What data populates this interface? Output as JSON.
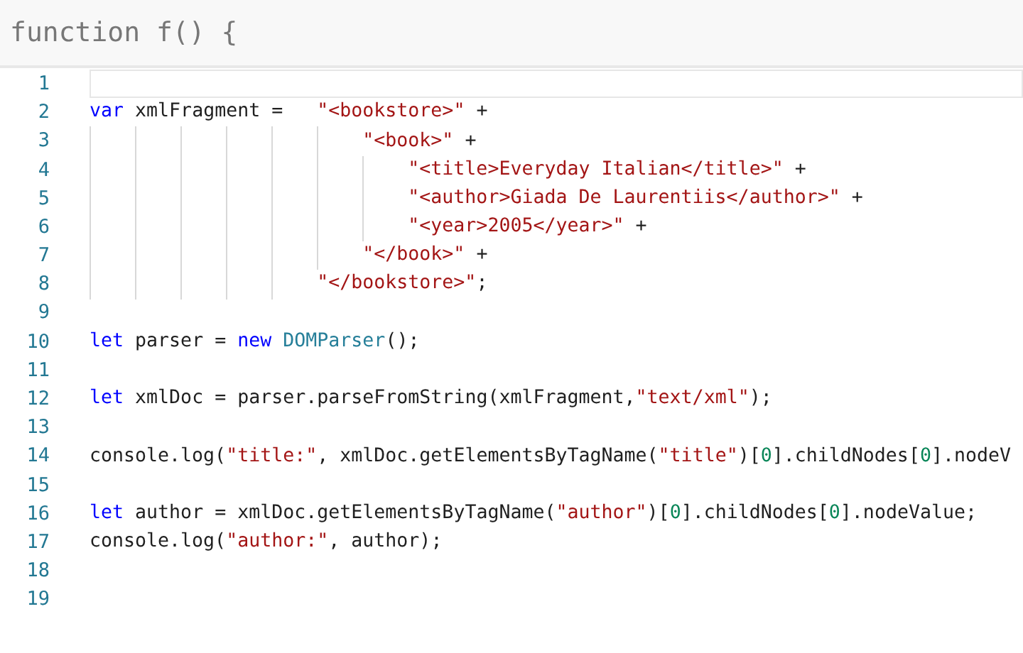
{
  "header": {
    "text": "function f() {"
  },
  "lines": [
    {
      "number": "1",
      "current": true
    },
    {
      "number": "2",
      "current": false,
      "tokens": [
        {
          "kind": "keyword",
          "text": "var"
        },
        {
          "kind": "plain",
          "text": " xmlFragment =   "
        },
        {
          "kind": "string",
          "text": "\"<bookstore>\""
        },
        {
          "kind": "plain",
          "text": " +"
        }
      ]
    },
    {
      "number": "3",
      "current": false,
      "tokens": [
        {
          "kind": "string",
          "text": "                        \"<book>\""
        },
        {
          "kind": "plain",
          "text": " +"
        }
      ]
    },
    {
      "number": "4",
      "current": false,
      "tokens": [
        {
          "kind": "string",
          "text": "                            \"<title>Everyday Italian</title>\""
        },
        {
          "kind": "plain",
          "text": " +"
        }
      ]
    },
    {
      "number": "5",
      "current": false,
      "tokens": [
        {
          "kind": "string",
          "text": "                            \"<author>Giada De Laurentiis</author>\""
        },
        {
          "kind": "plain",
          "text": " +"
        }
      ]
    },
    {
      "number": "6",
      "current": false,
      "tokens": [
        {
          "kind": "string",
          "text": "                            \"<year>2005</year>\""
        },
        {
          "kind": "plain",
          "text": " +"
        }
      ]
    },
    {
      "number": "7",
      "current": false,
      "tokens": [
        {
          "kind": "string",
          "text": "                        \"</book>\""
        },
        {
          "kind": "plain",
          "text": " +"
        }
      ]
    },
    {
      "number": "8",
      "current": false,
      "tokens": [
        {
          "kind": "string",
          "text": "                    \"</bookstore>\""
        },
        {
          "kind": "plain",
          "text": ";"
        }
      ]
    },
    {
      "number": "9",
      "current": false
    },
    {
      "number": "10",
      "current": false,
      "tokens": [
        {
          "kind": "keyword",
          "text": "let"
        },
        {
          "kind": "plain",
          "text": " parser = "
        },
        {
          "kind": "keyword",
          "text": "new"
        },
        {
          "kind": "type",
          "text": " DOMParser"
        },
        {
          "kind": "plain",
          "text": "();"
        }
      ]
    },
    {
      "number": "11",
      "current": false
    },
    {
      "number": "12",
      "current": false,
      "tokens": [
        {
          "kind": "keyword",
          "text": "let"
        },
        {
          "kind": "plain",
          "text": " xmlDoc = parser.parseFromString(xmlFragment,"
        },
        {
          "kind": "string",
          "text": "\"text/xml\""
        },
        {
          "kind": "plain",
          "text": ");"
        }
      ]
    },
    {
      "number": "13",
      "current": false
    },
    {
      "number": "14",
      "current": false,
      "tokens": [
        {
          "kind": "plain",
          "text": "console.log("
        },
        {
          "kind": "string",
          "text": "\"title:\""
        },
        {
          "kind": "plain",
          "text": ", xmlDoc.getElementsByTagName("
        },
        {
          "kind": "string",
          "text": "\"title\""
        },
        {
          "kind": "plain",
          "text": ")["
        },
        {
          "kind": "number",
          "text": "0"
        },
        {
          "kind": "plain",
          "text": "].childNodes["
        },
        {
          "kind": "number",
          "text": "0"
        },
        {
          "kind": "plain",
          "text": "].nodeV"
        }
      ]
    },
    {
      "number": "15",
      "current": false
    },
    {
      "number": "16",
      "current": false,
      "tokens": [
        {
          "kind": "keyword",
          "text": "let"
        },
        {
          "kind": "plain",
          "text": " author = xmlDoc.getElementsByTagName("
        },
        {
          "kind": "string",
          "text": "\"author\""
        },
        {
          "kind": "plain",
          "text": ")["
        },
        {
          "kind": "number",
          "text": "0"
        },
        {
          "kind": "plain",
          "text": "].childNodes["
        },
        {
          "kind": "number",
          "text": "0"
        },
        {
          "kind": "plain",
          "text": "].nodeValue;"
        }
      ]
    },
    {
      "number": "17",
      "current": false,
      "tokens": [
        {
          "kind": "plain",
          "text": "console.log("
        },
        {
          "kind": "string",
          "text": "\"author:\""
        },
        {
          "kind": "plain",
          "text": ", author);"
        }
      ]
    },
    {
      "number": "18",
      "current": false
    },
    {
      "number": "19",
      "current": false
    }
  ]
}
